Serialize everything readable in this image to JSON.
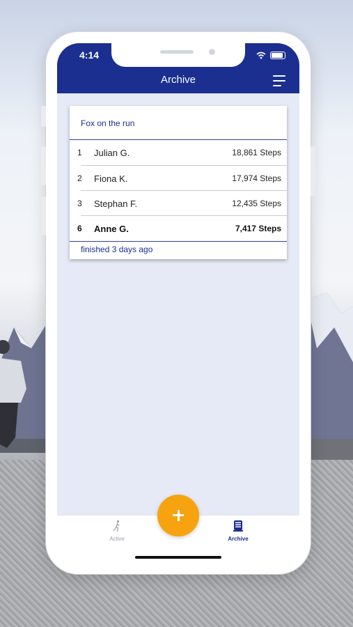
{
  "status": {
    "time": "4:14"
  },
  "header": {
    "title": "Archive"
  },
  "challenge": {
    "name": "Fox on the run",
    "rows": [
      {
        "rank": "1",
        "name": "Julian G.",
        "steps": "18,861 Steps",
        "me": false
      },
      {
        "rank": "2",
        "name": "Fiona K.",
        "steps": "17,974 Steps",
        "me": false
      },
      {
        "rank": "3",
        "name": "Stephan F.",
        "steps": "12,435 Steps",
        "me": false
      },
      {
        "rank": "6",
        "name": "Anne G.",
        "steps": "7,417 Steps",
        "me": true
      }
    ],
    "finished": "finished 3 days ago"
  },
  "tabs": {
    "active_label": "Active",
    "archive_label": "Archive"
  },
  "icons": {
    "menu": "hamburger-icon",
    "fab": "plus-icon",
    "active_tab": "runner-icon",
    "archive_tab": "archive-box-icon"
  },
  "colors": {
    "primary": "#1a2f8f",
    "accent": "#f7a310",
    "screen_bg": "#e6eaf6"
  }
}
